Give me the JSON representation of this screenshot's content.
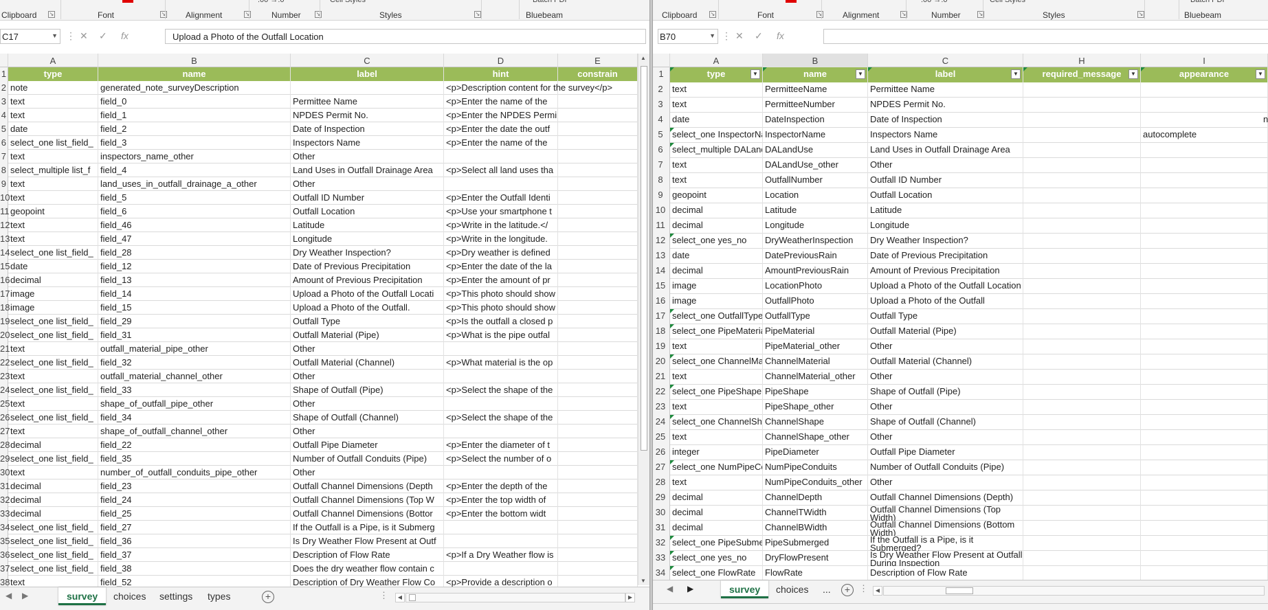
{
  "left": {
    "ribbon_groups": [
      "Clipboard",
      "Font",
      "Alignment",
      "Number",
      "Styles",
      "Bluebeam"
    ],
    "ribbon_top": [
      ".00 →.0",
      "Cell Styles",
      "Batch PDF"
    ],
    "name_box": "C17",
    "formula": "Upload a Photo of the Outfall Location",
    "columns": [
      "A",
      "B",
      "C",
      "D",
      "E"
    ],
    "header_row": {
      "a": "type",
      "b": "name",
      "c": "label",
      "d": "hint",
      "e": "constrain"
    },
    "rows": [
      {
        "n": "2",
        "a": "note",
        "b": "generated_note_surveyDescription",
        "c": "",
        "d": "<p>Description content for the survey</p>",
        "e": ""
      },
      {
        "n": "3",
        "a": "text",
        "b": "field_0",
        "c": "Permittee Name",
        "d": "<p>Enter the name of the",
        "e": ""
      },
      {
        "n": "4",
        "a": "text",
        "b": "field_1",
        "c": "NPDES Permit No.",
        "d": "<p>Enter the NPDES Permi",
        "e": ""
      },
      {
        "n": "5",
        "a": "date",
        "b": "field_2",
        "c": "Date of Inspection",
        "d": "<p>Enter the date the outf",
        "e": ""
      },
      {
        "n": "6",
        "a": "select_one list_field_",
        "b": "field_3",
        "c": "Inspectors Name",
        "d": "<p>Enter the name of the",
        "e": ""
      },
      {
        "n": "7",
        "a": "text",
        "b": "inspectors_name_other",
        "c": "Other",
        "d": "",
        "e": ""
      },
      {
        "n": "8",
        "a": "select_multiple list_f",
        "b": "field_4",
        "c": "Land Uses in Outfall Drainage Area",
        "d": "<p>Select all land uses tha",
        "e": ""
      },
      {
        "n": "9",
        "a": "text",
        "b": "land_uses_in_outfall_drainage_a_other",
        "c": "Other",
        "d": "",
        "e": ""
      },
      {
        "n": "10",
        "a": "text",
        "b": "field_5",
        "c": "Outfall ID Number",
        "d": "<p>Enter the Outfall Identi",
        "e": ""
      },
      {
        "n": "11",
        "a": "geopoint",
        "b": "field_6",
        "c": "Outfall Location",
        "d": "<p>Use your smartphone t",
        "e": ""
      },
      {
        "n": "12",
        "a": "text",
        "b": "field_46",
        "c": "Latitude",
        "d": "<p>Write in the latitude.</",
        "e": ""
      },
      {
        "n": "13",
        "a": "text",
        "b": "field_47",
        "c": "Longitude",
        "d": "<p>Write in the longitude.",
        "e": ""
      },
      {
        "n": "14",
        "a": "select_one list_field_",
        "b": "field_28",
        "c": "Dry Weather Inspection?",
        "d": "<p>Dry weather is defined",
        "e": ""
      },
      {
        "n": "15",
        "a": "date",
        "b": "field_12",
        "c": "Date of Previous Precipitation",
        "d": "<p>Enter the date of the la",
        "e": ""
      },
      {
        "n": "16",
        "a": "decimal",
        "b": "field_13",
        "c": "Amount of Previous Precipitation",
        "d": "<p>Enter the amount of pr",
        "e": ""
      },
      {
        "n": "17",
        "a": "image",
        "b": "field_14",
        "c": "Upload a Photo of the Outfall Locati",
        "d": "<p>This photo should show",
        "e": ""
      },
      {
        "n": "18",
        "a": "image",
        "b": "field_15",
        "c": "Upload a Photo of the Outfall.",
        "d": "<p>This photo should show",
        "e": ""
      },
      {
        "n": "19",
        "a": "select_one list_field_",
        "b": "field_29",
        "c": "Outfall Type",
        "d": "<p>Is the outfall a closed p",
        "e": ""
      },
      {
        "n": "20",
        "a": "select_one list_field_",
        "b": "field_31",
        "c": "Outfall Material (Pipe)",
        "d": "<p>What is the pipe outfal",
        "e": ""
      },
      {
        "n": "21",
        "a": "text",
        "b": "outfall_material_pipe_other",
        "c": "Other",
        "d": "",
        "e": ""
      },
      {
        "n": "22",
        "a": "select_one list_field_",
        "b": "field_32",
        "c": "Outfall Material (Channel)",
        "d": "<p>What material is the op",
        "e": ""
      },
      {
        "n": "23",
        "a": "text",
        "b": "outfall_material_channel_other",
        "c": "Other",
        "d": "",
        "e": ""
      },
      {
        "n": "24",
        "a": "select_one list_field_",
        "b": "field_33",
        "c": "Shape of Outfall (Pipe)",
        "d": "<p>Select the shape of the",
        "e": ""
      },
      {
        "n": "25",
        "a": "text",
        "b": "shape_of_outfall_pipe_other",
        "c": "Other",
        "d": "",
        "e": ""
      },
      {
        "n": "26",
        "a": "select_one list_field_",
        "b": "field_34",
        "c": "Shape of Outfall (Channel)",
        "d": "<p>Select the shape of the",
        "e": ""
      },
      {
        "n": "27",
        "a": "text",
        "b": "shape_of_outfall_channel_other",
        "c": "Other",
        "d": "",
        "e": ""
      },
      {
        "n": "28",
        "a": "decimal",
        "b": "field_22",
        "c": "Outfall Pipe Diameter",
        "d": "<p>Enter the diameter of t",
        "e": ""
      },
      {
        "n": "29",
        "a": "select_one list_field_",
        "b": "field_35",
        "c": "Number of Outfall Conduits (Pipe)",
        "d": "<p>Select the number of o",
        "e": ""
      },
      {
        "n": "30",
        "a": "text",
        "b": "number_of_outfall_conduits_pipe_other",
        "c": "Other",
        "d": "",
        "e": ""
      },
      {
        "n": "31",
        "a": "decimal",
        "b": "field_23",
        "c": "Outfall Channel Dimensions (Depth",
        "d": "<p>Enter the depth of the",
        "e": ""
      },
      {
        "n": "32",
        "a": "decimal",
        "b": "field_24",
        "c": "Outfall Channel Dimensions (Top W",
        "d": "<p>Enter the top width of",
        "e": ""
      },
      {
        "n": "33",
        "a": "decimal",
        "b": "field_25",
        "c": "Outfall Channel Dimensions (Bottor",
        "d": "<p>Enter the bottom widt",
        "e": ""
      },
      {
        "n": "34",
        "a": "select_one list_field_",
        "b": "field_27",
        "c": "If the Outfall is a Pipe, is it Submerg",
        "d": "",
        "e": ""
      },
      {
        "n": "35",
        "a": "select_one list_field_",
        "b": "field_36",
        "c": "Is Dry Weather Flow Present at Outf",
        "d": "",
        "e": ""
      },
      {
        "n": "36",
        "a": "select_one list_field_",
        "b": "field_37",
        "c": "Description of Flow Rate",
        "d": "<p>If a Dry Weather flow is",
        "e": ""
      },
      {
        "n": "37",
        "a": "select_one list_field_",
        "b": "field_38",
        "c": "Does the dry weather flow contain c",
        "d": "",
        "e": ""
      },
      {
        "n": "38",
        "a": "text",
        "b": "field_52",
        "c": "Description of Dry Weather Flow Co",
        "d": "<p>Provide a description o",
        "e": ""
      }
    ],
    "tabs": [
      "survey",
      "choices",
      "settings",
      "types"
    ],
    "active_tab": "survey"
  },
  "right": {
    "ribbon_groups": [
      "Clipboard",
      "Font",
      "Alignment",
      "Number",
      "Styles",
      "Bluebeam"
    ],
    "ribbon_top": [
      ".00 →.0",
      "Cell Styles",
      "Batch PDF"
    ],
    "name_box": "B70",
    "formula": "",
    "columns": [
      "A",
      "B",
      "C",
      "H",
      "I"
    ],
    "header_row": {
      "a": "type",
      "b": "name",
      "c": "label",
      "h": "required_message",
      "i": "appearance"
    },
    "rows": [
      {
        "n": "2",
        "a": "text",
        "b": "PermitteeName",
        "c": "Permittee Name",
        "h": "",
        "i": ""
      },
      {
        "n": "3",
        "a": "text",
        "b": "PermitteeNumber",
        "c": "NPDES Permit No.",
        "h": "",
        "i": ""
      },
      {
        "n": "4",
        "a": "date",
        "b": "DateInspection",
        "c": "Date of Inspection",
        "h": "",
        "i": "",
        "j": "nc"
      },
      {
        "n": "5",
        "a": "select_one InspectorNa",
        "b": "InspectorName",
        "c": "Inspectors Name",
        "h": "",
        "i": "autocomplete"
      },
      {
        "n": "6",
        "a": "select_multiple DALand",
        "b": "DALandUse",
        "c": "Land Uses in Outfall Drainage Area",
        "h": "",
        "i": ""
      },
      {
        "n": "7",
        "a": "text",
        "b": "DALandUse_other",
        "c": "Other",
        "h": "",
        "i": ""
      },
      {
        "n": "8",
        "a": "text",
        "b": "OutfallNumber",
        "c": "Outfall ID Number",
        "h": "",
        "i": ""
      },
      {
        "n": "9",
        "a": "geopoint",
        "b": "Location",
        "c": "Outfall Location",
        "h": "",
        "i": ""
      },
      {
        "n": "10",
        "a": "decimal",
        "b": "Latitude",
        "c": "Latitude",
        "h": "",
        "i": ""
      },
      {
        "n": "11",
        "a": "decimal",
        "b": "Longitude",
        "c": "Longitude",
        "h": "",
        "i": ""
      },
      {
        "n": "12",
        "a": "select_one yes_no",
        "b": "DryWeatherInspection",
        "c": "Dry Weather Inspection?",
        "h": "",
        "i": ""
      },
      {
        "n": "13",
        "a": "date",
        "b": "DatePreviousRain",
        "c": "Date of Previous Precipitation",
        "h": "",
        "i": ""
      },
      {
        "n": "14",
        "a": "decimal",
        "b": "AmountPreviousRain",
        "c": "Amount of Previous Precipitation",
        "h": "",
        "i": ""
      },
      {
        "n": "15",
        "a": "image",
        "b": "LocationPhoto",
        "c": "Upload a Photo of the Outfall Location",
        "h": "",
        "i": ""
      },
      {
        "n": "16",
        "a": "image",
        "b": "OutfallPhoto",
        "c": "Upload a Photo of the Outfall",
        "h": "",
        "i": ""
      },
      {
        "n": "17",
        "a": "select_one OutfallType",
        "b": "OutfallType",
        "c": "Outfall Type",
        "h": "",
        "i": ""
      },
      {
        "n": "18",
        "a": "select_one PipeMateria",
        "b": "PipeMaterial",
        "c": "Outfall Material (Pipe)",
        "h": "",
        "i": ""
      },
      {
        "n": "19",
        "a": "text",
        "b": "PipeMaterial_other",
        "c": "Other",
        "h": "",
        "i": ""
      },
      {
        "n": "20",
        "a": "select_one ChannelMa",
        "b": "ChannelMaterial",
        "c": "Outfall Material (Channel)",
        "h": "",
        "i": ""
      },
      {
        "n": "21",
        "a": "text",
        "b": "ChannelMaterial_other",
        "c": "Other",
        "h": "",
        "i": ""
      },
      {
        "n": "22",
        "a": "select_one PipeShape",
        "b": "PipeShape",
        "c": "Shape of Outfall (Pipe)",
        "h": "",
        "i": ""
      },
      {
        "n": "23",
        "a": "text",
        "b": "PipeShape_other",
        "c": "Other",
        "h": "",
        "i": ""
      },
      {
        "n": "24",
        "a": "select_one ChannelSha",
        "b": "ChannelShape",
        "c": "Shape of Outfall (Channel)",
        "h": "",
        "i": ""
      },
      {
        "n": "25",
        "a": "text",
        "b": "ChannelShape_other",
        "c": "Other",
        "h": "",
        "i": ""
      },
      {
        "n": "26",
        "a": "integer",
        "b": "PipeDiameter",
        "c": "Outfall Pipe Diameter",
        "h": "",
        "i": ""
      },
      {
        "n": "27",
        "a": "select_one NumPipeCo",
        "b": "NumPipeConduits",
        "c": "Number of Outfall Conduits (Pipe)",
        "h": "",
        "i": ""
      },
      {
        "n": "28",
        "a": "text",
        "b": "NumPipeConduits_other",
        "c": "Other",
        "h": "",
        "i": ""
      },
      {
        "n": "29",
        "a": "decimal",
        "b": "ChannelDepth",
        "c": "Outfall Channel Dimensions (Depth)",
        "h": "",
        "i": ""
      },
      {
        "n": "30",
        "a": "decimal",
        "b": "ChannelTWidth",
        "c": "Outfall Channel Dimensions (Top Width)",
        "h": "",
        "i": "",
        "wrap": true
      },
      {
        "n": "31",
        "a": "decimal",
        "b": "ChannelBWidth",
        "c": "Outfall Channel Dimensions (Bottom Width)",
        "h": "",
        "i": "",
        "wrap": true
      },
      {
        "n": "32",
        "a": "select_one PipeSubme",
        "b": "PipeSubmerged",
        "c": "If the Outfall is a Pipe, is it Submerged?",
        "h": "",
        "i": "",
        "wrap": true
      },
      {
        "n": "33",
        "a": "select_one yes_no",
        "b": "DryFlowPresent",
        "c": "Is Dry Weather Flow Present at Outfall During Inspection",
        "h": "",
        "i": "",
        "wrap": true
      },
      {
        "n": "34",
        "a": "select_one FlowRate",
        "b": "FlowRate",
        "c": "Description of Flow Rate",
        "h": "",
        "i": ""
      }
    ],
    "tabs": [
      "survey",
      "choices",
      "..."
    ],
    "active_tab": "survey"
  }
}
